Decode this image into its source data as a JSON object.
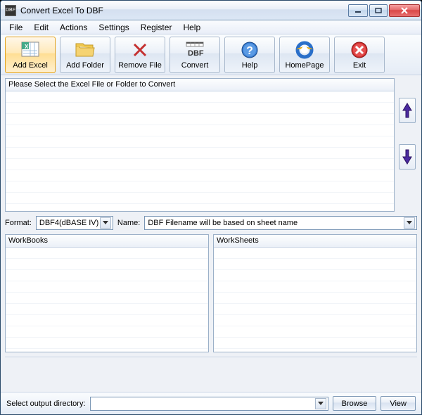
{
  "window": {
    "title": "Convert Excel To DBF"
  },
  "menu": {
    "file": "File",
    "edit": "Edit",
    "actions": "Actions",
    "settings": "Settings",
    "register": "Register",
    "help": "Help"
  },
  "toolbar": {
    "add_excel": "Add Excel",
    "add_folder": "Add Folder",
    "remove_file": "Remove File",
    "convert": "Convert",
    "help": "Help",
    "homepage": "HomePage",
    "exit": "Exit"
  },
  "files_panel": {
    "header": "Please Select the Excel File or Folder to Convert"
  },
  "format": {
    "label": "Format:",
    "value": "DBF4(dBASE IV)"
  },
  "name": {
    "label": "Name:",
    "value": "DBF Filename will be based on sheet name"
  },
  "workbooks": {
    "header": "WorkBooks"
  },
  "worksheets": {
    "header": "WorkSheets"
  },
  "output": {
    "label": "Select  output directory:",
    "value": "",
    "browse": "Browse",
    "view": "View"
  },
  "icon_names": {
    "app": "app-icon",
    "minimize": "minimize-icon",
    "maximize": "maximize-icon",
    "close": "close-icon",
    "excel": "excel-icon",
    "folder": "folder-icon",
    "remove": "remove-x-icon",
    "dbf": "dbf-icon",
    "help": "help-icon",
    "ie": "ie-icon",
    "exit": "exit-x-icon",
    "up": "arrow-up-icon",
    "down": "arrow-down-icon",
    "dropdown": "dropdown-chevron-icon"
  }
}
